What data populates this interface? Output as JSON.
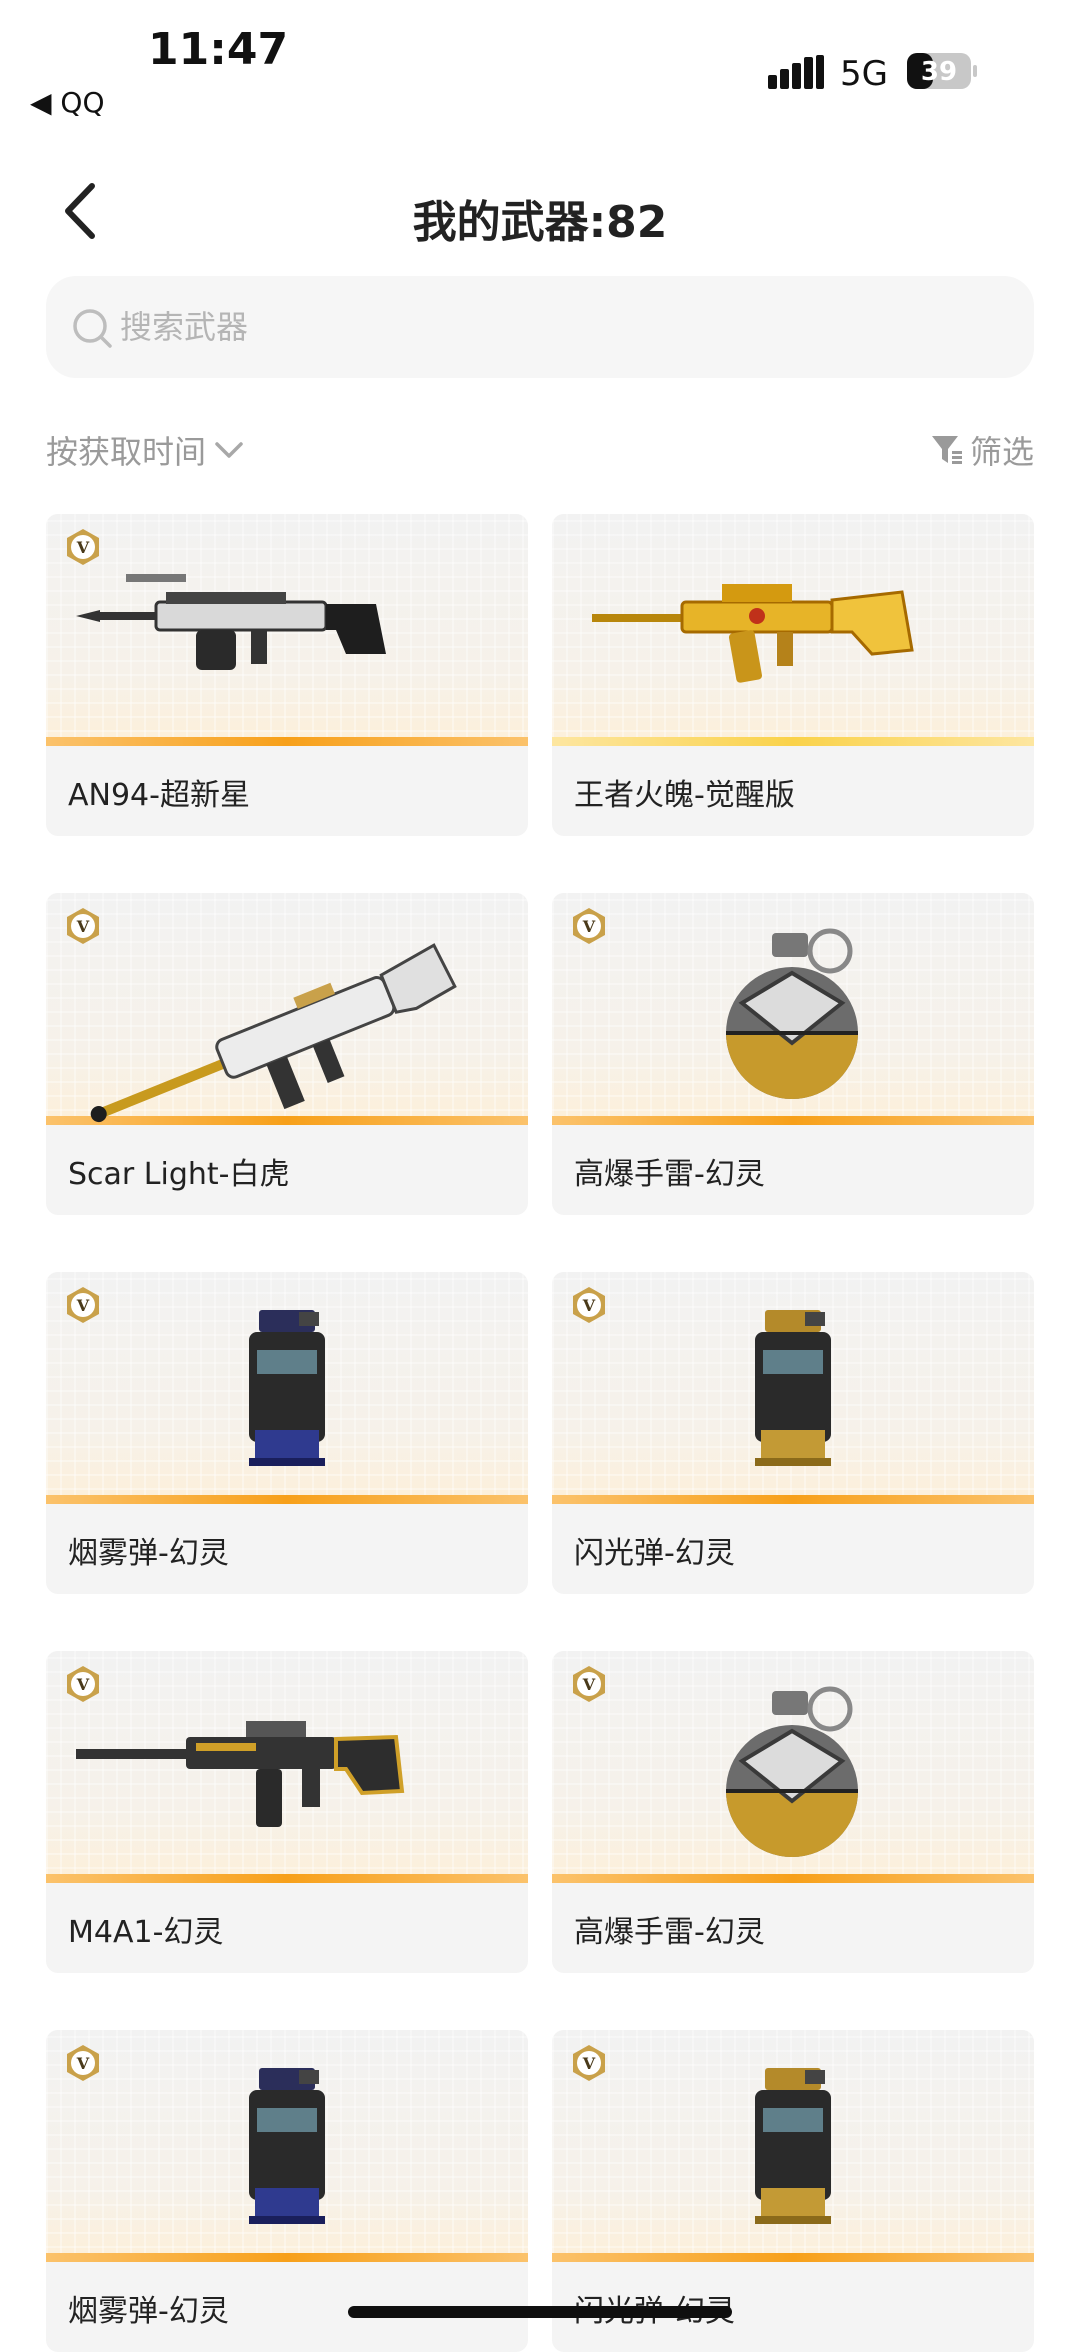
{
  "status_bar": {
    "time": "11:47",
    "back_app": "◀ QQ",
    "network": "5G",
    "battery": "39"
  },
  "nav": {
    "title": "我的武器:82"
  },
  "search": {
    "placeholder": "搜索武器"
  },
  "toolbar": {
    "sort_label": "按获取时间",
    "filter_label": "筛选"
  },
  "colors": {
    "accent_bar": "#f7a01a",
    "gold_bar": "#fad24a",
    "badge_gold": "#c9a14a"
  },
  "weapons": [
    {
      "name": "AN94-超新星",
      "badge": "V",
      "art": "rifle-silver"
    },
    {
      "name": "王者火魄-觉醒版",
      "badge": "",
      "art": "rifle-gold"
    },
    {
      "name": "Scar Light-白虎",
      "badge": "V",
      "art": "rifle-white-tiger"
    },
    {
      "name": "高爆手雷-幻灵",
      "badge": "V",
      "art": "grenade"
    },
    {
      "name": "烟雾弹-幻灵",
      "badge": "V",
      "art": "smoke-blue"
    },
    {
      "name": "闪光弹-幻灵",
      "badge": "V",
      "art": "flash-gold"
    },
    {
      "name": "M4A1-幻灵",
      "badge": "V",
      "art": "rifle-m4"
    },
    {
      "name": "高爆手雷-幻灵",
      "badge": "V",
      "art": "grenade"
    },
    {
      "name": "烟雾弹-幻灵",
      "badge": "V",
      "art": "smoke-blue"
    },
    {
      "name": "闪光弹-幻灵",
      "badge": "V",
      "art": "flash-gold"
    }
  ]
}
